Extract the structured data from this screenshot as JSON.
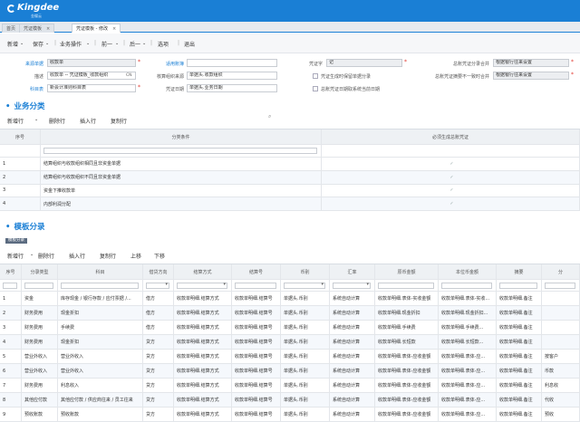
{
  "header": {
    "brand": "Kingdee",
    "brand_sub": "金蝶云"
  },
  "tabs": [
    {
      "label": "首页"
    },
    {
      "label": "凭证模板",
      "close": "×"
    },
    {
      "label": "凭证模板 - 修改",
      "close": "×"
    }
  ],
  "toolbar": {
    "items": [
      "新增",
      "保存",
      "业务操作",
      "前一",
      "后一",
      "选项",
      "退出"
    ],
    "arrows": [
      "⌄",
      "⌄",
      "⌄",
      "⌄",
      "⌄"
    ],
    "sep": "|"
  },
  "form": {
    "row1": {
      "l1": "来源单据",
      "v1": "收款单",
      "l2": "适用账簿",
      "v2": "",
      "l3": "凭证字",
      "v3": "记",
      "l4": "总账凭证分录合并",
      "v4": "根据银行往来设置"
    },
    "row2": {
      "l1": "描述",
      "v1": "收款单 -- 凭证模板_收款组织",
      "v1b": "CN",
      "l2": "核算组织来源",
      "v2": "单据头.收款组织",
      "c1": "凭证生成时保留单据分录",
      "l4": "总账凭证摘要不一致时合并",
      "v4": "根据银行往来设置"
    },
    "row3": {
      "l1": "科目表",
      "v1": "新会计准则科目表",
      "l2": "凭证日期",
      "v2": "单据头.业务日期",
      "c2": "总账凭证日期取系统当前日期"
    }
  },
  "section1": {
    "title": "业务分类",
    "bar": [
      "新增行",
      "⌄",
      "删除行",
      "插入行",
      "复制行"
    ],
    "headers": [
      "序号",
      "分类条件",
      "必须生成总账凭证"
    ],
    "rows": [
      {
        "no": "1",
        "cond": "结算组织与收款组织相同且非资金单据",
        "check": "✓"
      },
      {
        "no": "2",
        "cond": "结算组织与收款组织不同且非资金单据",
        "check": "✓"
      },
      {
        "no": "3",
        "cond": "资金下推收款单",
        "check": "✓"
      },
      {
        "no": "4",
        "cond": "内部利润分配",
        "check": "✓"
      }
    ]
  },
  "section2": {
    "title": "模板分录",
    "subtab": "模板分录",
    "bar": [
      "新增行",
      "⌄",
      "删除行",
      "插入行",
      "复制行",
      "上移",
      "下移"
    ],
    "headers": [
      "序号",
      "分录类型",
      "科目",
      "借贷方向",
      "结算方式",
      "结算号",
      "币别",
      "汇率",
      "原币金额",
      "本位币金额",
      "摘要",
      "分"
    ],
    "rows": [
      [
        "1",
        "资金",
        "库存现金 / 银行存款 / 应付票据 /...",
        "借方",
        "收款单明细.结算方式",
        "收款单明细.结算号",
        "单据头.币别",
        "系统自动计算",
        "收款单明细.表体-实收金额",
        "收款单明细.表体-实收...",
        "收款单明细.备注",
        ""
      ],
      [
        "2",
        "财务费用",
        "现金折扣",
        "借方",
        "收款单明细.结算方式",
        "收款单明细.结算号",
        "单据头.币别",
        "系统自动计算",
        "收款单明细.现金折扣",
        "收款单明细.现金折扣...",
        "收款单明细.备注",
        ""
      ],
      [
        "3",
        "财务费用",
        "手续费",
        "借方",
        "收款单明细.结算方式",
        "收款单明细.结算号",
        "单据头.币别",
        "系统自动计算",
        "收款单明细.手续费",
        "收款单明细.手续费...",
        "收款单明细.备注",
        ""
      ],
      [
        "4",
        "财务费用",
        "现金折扣",
        "贷方",
        "收款单明细.结算方式",
        "收款单明细.结算号",
        "单据头.币别",
        "系统自动计算",
        "收款单明细.长短款",
        "收款单明细.长短款...",
        "收款单明细.备注",
        ""
      ],
      [
        "5",
        "营业外收入",
        "营业外收入",
        "贷方",
        "收款单明细.结算方式",
        "收款单明细.结算号",
        "单据头.币别",
        "系统自动计算",
        "收款单明细.表体-应收金额",
        "收款单明细.表体-应...",
        "收款单明细.备注",
        "按客户"
      ],
      [
        "6",
        "营业外收入",
        "营业外收入",
        "贷方",
        "收款单明细.结算方式",
        "收款单明细.结算号",
        "单据头.币别",
        "系统自动计算",
        "收款单明细.表体-应收金额",
        "收款单明细.表体-应...",
        "收款单明细.备注",
        "币款"
      ],
      [
        "7",
        "财务费用",
        "利息收入",
        "贷方",
        "收款单明细.结算方式",
        "收款单明细.结算号",
        "单据头.币别",
        "系统自动计算",
        "收款单明细.表体-应收金额",
        "收款单明细.表体-应...",
        "收款单明细.备注",
        "利息收"
      ],
      [
        "8",
        "其他应付款",
        "其他应付款 / 供应商往来 / 员工往来",
        "贷方",
        "收款单明细.结算方式",
        "收款单明细.结算号",
        "单据头.币别",
        "系统自动计算",
        "收款单明细.表体-应收金额",
        "收款单明细.表体-应...",
        "收款单明细.备注",
        "代收"
      ],
      [
        "9",
        "预收账款",
        "预收账款",
        "贷方",
        "收款单明细.结算方式",
        "收款单明细.结算号",
        "单据头.币别",
        "系统自动计算",
        "收款单明细.表体-应收金额",
        "收款单明细.表体-应...",
        "收款单明细.备注",
        "预收"
      ]
    ]
  }
}
